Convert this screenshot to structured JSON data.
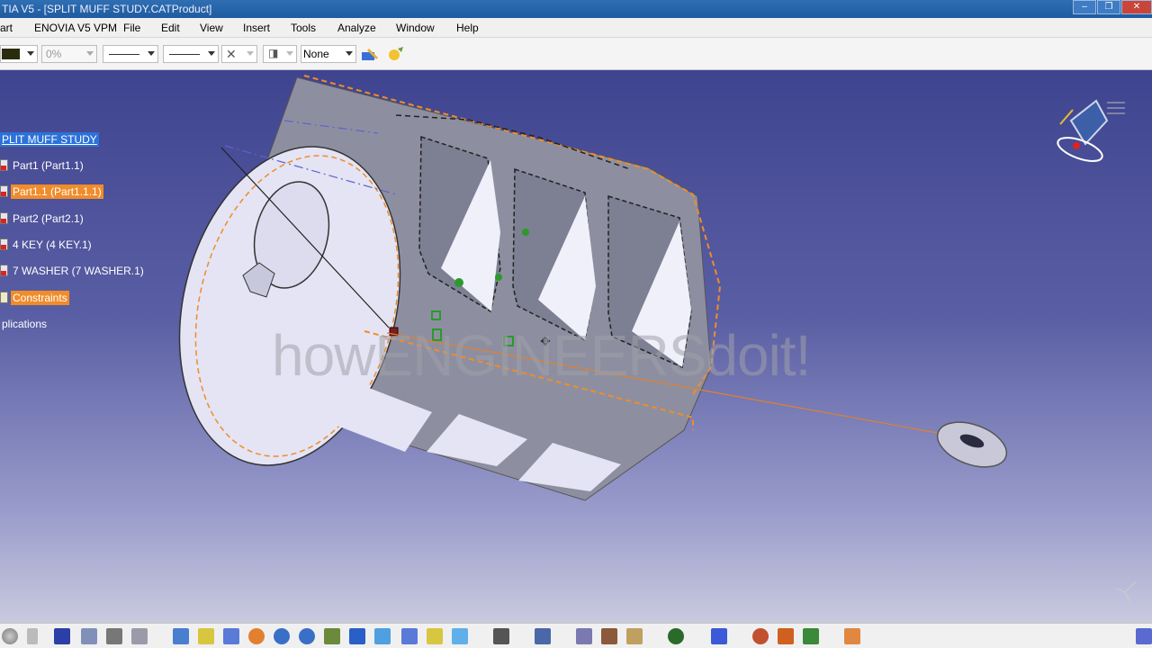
{
  "window": {
    "title": "TIA V5 - [SPLIT MUFF STUDY.CATProduct]",
    "buttons": [
      "–",
      "❐",
      "✕"
    ]
  },
  "menubar": {
    "items": [
      "art",
      "ENOVIA V5 VPM",
      "File",
      "Edit",
      "View",
      "Insert",
      "Tools",
      "Analyze",
      "Window",
      "Help"
    ]
  },
  "toolbar": {
    "transparency": "0%",
    "layer": "None"
  },
  "tree": {
    "root": "PLIT MUFF STUDY",
    "items": [
      {
        "label": "Part1 (Part1.1)",
        "highlight": false
      },
      {
        "label": "Part1.1 (Part1.1.1)",
        "highlight": true
      },
      {
        "label": "Part2 (Part2.1)",
        "highlight": false
      },
      {
        "label": "4 KEY (4 KEY.1)",
        "highlight": false
      },
      {
        "label": "7 WASHER (7 WASHER.1)",
        "highlight": false
      },
      {
        "label": "Constraints",
        "highlight": true
      },
      {
        "label": "plications",
        "highlight": false
      }
    ]
  },
  "watermark": "howENGINEERSdoit!",
  "colors": {
    "selection_orange": "#f08c2a",
    "tree_root_blue": "#2c72d8",
    "viewport_top": "#3f4490",
    "viewport_bottom": "#c9cadf"
  }
}
